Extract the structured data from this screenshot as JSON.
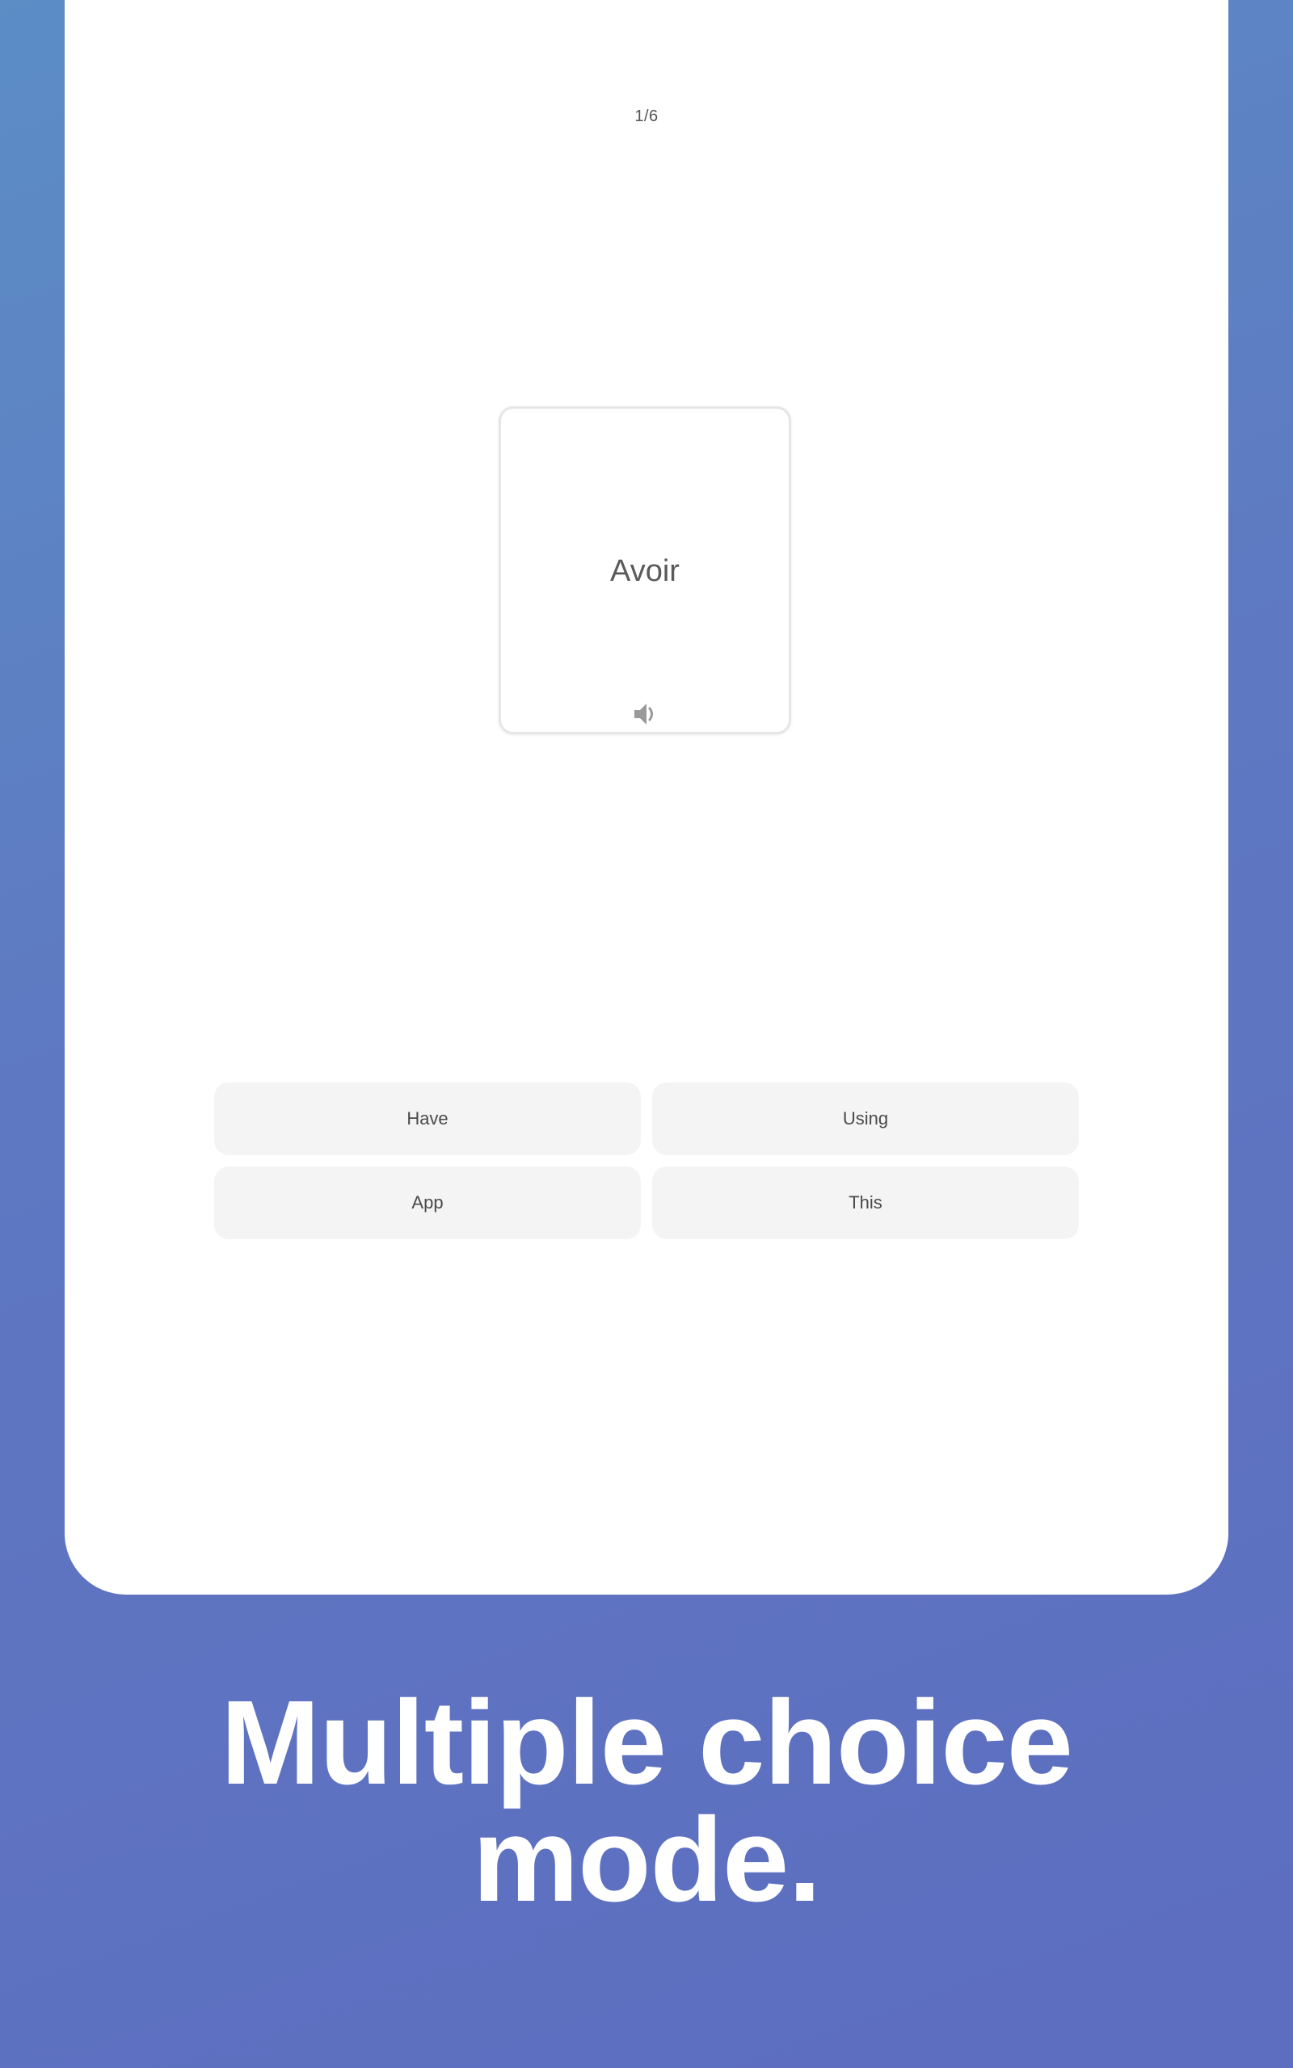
{
  "progress": {
    "label": "1/6",
    "current": 1,
    "total": 6
  },
  "flashcard": {
    "term": "Avoir",
    "audio_icon": "speaker-icon"
  },
  "choices": [
    {
      "label": "Have"
    },
    {
      "label": "Using"
    },
    {
      "label": "App"
    },
    {
      "label": "This"
    }
  ],
  "headline": {
    "line1": "Multiple choice",
    "line2": "mode."
  },
  "colors": {
    "background_top": "#5c8dc5",
    "background_bottom": "#5d6dc0",
    "screen": "#ffffff",
    "choice_background": "#f4f4f4",
    "text": "#4a4a4a",
    "headline": "#ffffff"
  }
}
